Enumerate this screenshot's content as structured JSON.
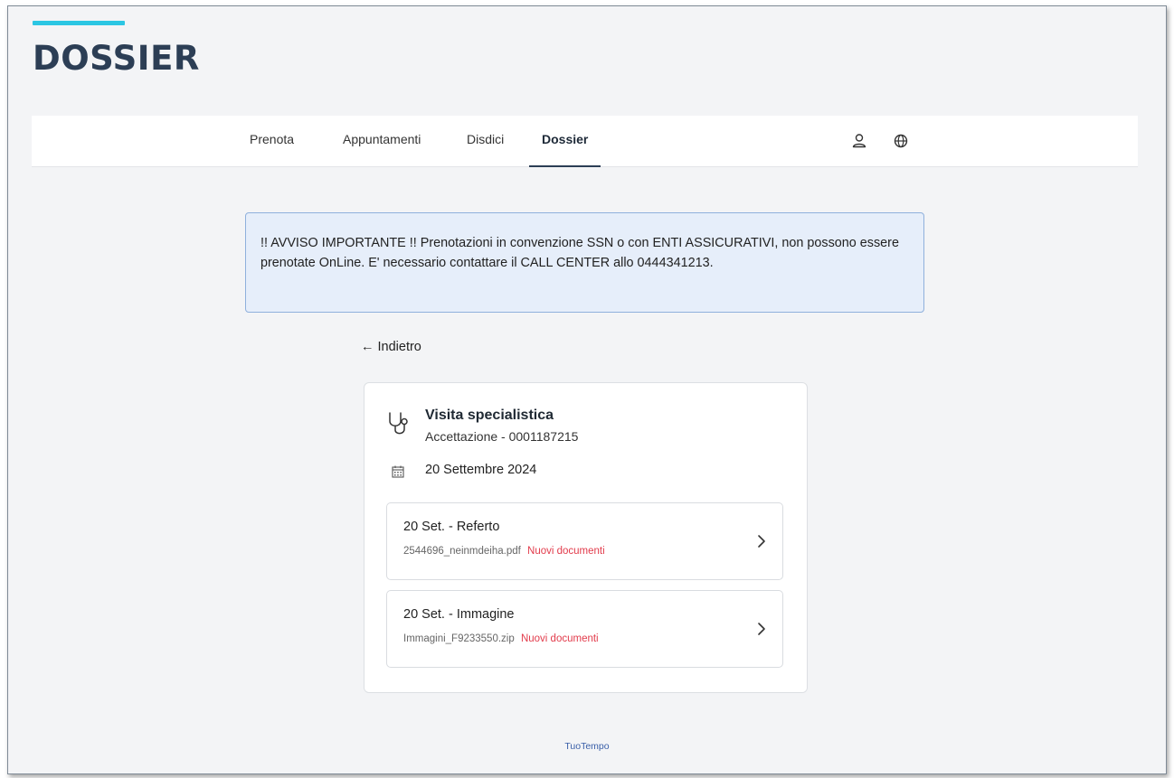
{
  "header": {
    "title": "DOSSIER",
    "accent_color": "#2bc6e3"
  },
  "nav": {
    "items": [
      {
        "label": "Prenota",
        "active": false
      },
      {
        "label": "Appuntamenti",
        "active": false
      },
      {
        "label": "Disdici",
        "active": false
      },
      {
        "label": "Dossier",
        "active": true
      }
    ],
    "icons": [
      "user-icon",
      "globe-icon"
    ]
  },
  "notice": {
    "text": "!! AVVISO IMPORTANTE !! Prenotazioni in convenzione SSN o con ENTI ASSICURATIVI, non possono essere prenotate OnLine. E' necessario contattare il CALL CENTER allo 0444341213.",
    "background": "#e6eefa",
    "border": "#8fb0dc"
  },
  "back": {
    "arrow": "←",
    "label": "Indietro"
  },
  "exam": {
    "icon": "stethoscope-icon",
    "title": "Visita specialistica",
    "subtitle": "Accettazione - 0001187215",
    "date_icon": "calendar-icon",
    "date": "20 Settembre 2024",
    "documents": [
      {
        "title": "20 Set. - Referto",
        "file": "2544696_neinmdeiha.pdf",
        "badge": "Nuovi documenti"
      },
      {
        "title": "20 Set. - Immagine",
        "file": "Immagini_F9233550.zip",
        "badge": "Nuovi documenti"
      }
    ],
    "badge_color": "#e23b4b"
  },
  "footer": {
    "link": "TuoTempo"
  }
}
